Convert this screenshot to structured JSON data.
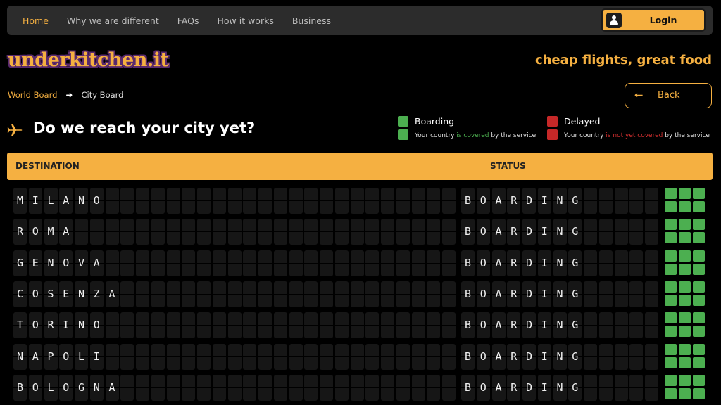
{
  "nav": {
    "links": [
      "Home",
      "Why we are different",
      "FAQs",
      "How it works",
      "Business"
    ],
    "active_index": 0,
    "login_label": "Login"
  },
  "brand": {
    "logo_text": "underkitchen.it",
    "tagline": "cheap flights, great food"
  },
  "breadcrumb": {
    "parent": "World Board",
    "current": "City Board"
  },
  "back_label": "Back",
  "page_title": "Do we reach your city yet?",
  "legend": {
    "boarding": {
      "title": "Boarding",
      "desc_pre": "Your country ",
      "desc_highlight": "is covered",
      "desc_post": " by the service"
    },
    "delayed": {
      "title": "Delayed",
      "desc_pre": "Your country ",
      "desc_highlight": "is not yet covered",
      "desc_post": " by the service"
    }
  },
  "table": {
    "col_destination": "DESTINATION",
    "col_status": "STATUS",
    "rows": [
      {
        "destination": "MILANO",
        "status": "BOARDING",
        "status_type": "boarding"
      },
      {
        "destination": "ROMA",
        "status": "BOARDING",
        "status_type": "boarding"
      },
      {
        "destination": "GENOVA",
        "status": "BOARDING",
        "status_type": "boarding"
      },
      {
        "destination": "COSENZA",
        "status": "BOARDING",
        "status_type": "boarding"
      },
      {
        "destination": "TORINO",
        "status": "BOARDING",
        "status_type": "boarding"
      },
      {
        "destination": "NAPOLI",
        "status": "BOARDING",
        "status_type": "boarding"
      },
      {
        "destination": "BOLOGNA",
        "status": "BOARDING",
        "status_type": "boarding"
      }
    ]
  },
  "colors": {
    "accent": "#f5b041",
    "boarding": "#4caf50",
    "delayed": "#c62828",
    "background": "#000000"
  },
  "icons": {
    "plane": "plane-icon",
    "user": "user-icon",
    "arrow_right": "arrow-right-icon",
    "arrow_left": "arrow-left-icon"
  }
}
